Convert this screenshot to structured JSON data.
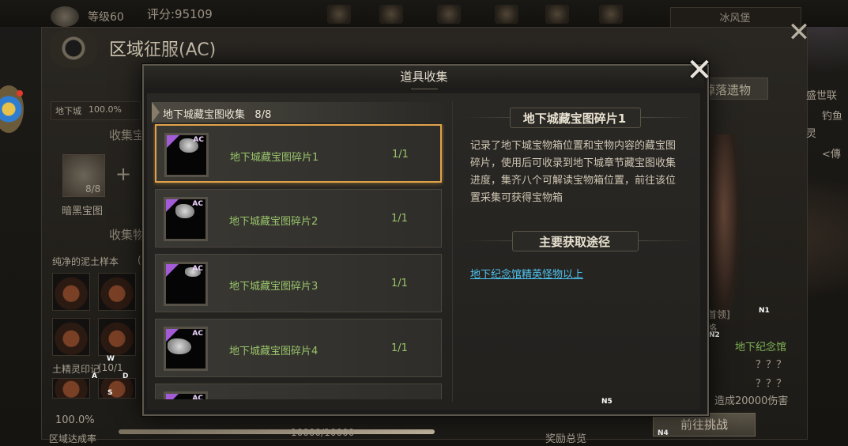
{
  "hud": {
    "level": "等级60",
    "score": "评分:95109",
    "city": "冰风堡"
  },
  "region": {
    "title": "区域征服(AC)",
    "dungeon_label": "地下城",
    "dungeon_percent": "100.0%",
    "collect_treasure_label": "收集宝",
    "map_count": "8/8",
    "map_name": "暗黑宝图",
    "collect_item_label": "收集物",
    "sample_label": "纯净的泥土样本",
    "sample_bracket": "(",
    "earth_spirit_label": "土精灵印记",
    "earth_spirit_count": "(10/1",
    "progress_percent": "100.0%",
    "progress_label": "区域达成率",
    "progress_value": "10000/10000",
    "progress_fraction": 1.0,
    "reward_label": "奖励总览",
    "right_tab": "掉落遗物",
    "right_frag_1": "盛世联",
    "right_frag_2": "钓鱼",
    "right_frag_3": "灵",
    "right_frag_4": "<傳",
    "right_frag_5": "首领]",
    "right_frag_6": "格",
    "dungeon_memorial": "地下纪念馆",
    "unknown_1": "？？？",
    "unknown_2": "？？？",
    "damage_text": "造成20000伤害",
    "challenge_button": "前往挑战"
  },
  "controls": {
    "w": "W",
    "a": "A",
    "s": "S",
    "d": "D",
    "n1": "N1",
    "n2": "N2",
    "n3": "N3",
    "n4": "N4",
    "n5": "N5"
  },
  "modal": {
    "title": "道具收集",
    "collection_header": "地下城藏宝图收集",
    "collection_progress": "8/8",
    "items": [
      {
        "name": "地下城藏宝图碎片1",
        "count": "1/1",
        "badge": "AC",
        "selected": true
      },
      {
        "name": "地下城藏宝图碎片2",
        "count": "1/1",
        "badge": "AC",
        "selected": false
      },
      {
        "name": "地下城藏宝图碎片3",
        "count": "1/1",
        "badge": "AC",
        "selected": false
      },
      {
        "name": "地下城藏宝图碎片4",
        "count": "1/1",
        "badge": "AC",
        "selected": false
      },
      {
        "name": "",
        "count": "",
        "badge": "AC",
        "selected": false
      }
    ],
    "detail": {
      "title": "地下城藏宝图碎片1",
      "description": "记录了地下城宝物箱位置和宝物内容的藏宝图碎片，使用后可收录到地下城章节藏宝图收集进度，集齐八个可解读宝物箱位置，前往该位置采集可获得宝物箱",
      "source_title": "主要获取途径",
      "source_link": "地下纪念馆精英怪物以上"
    }
  },
  "colors": {
    "selected_border": "#e0a24a",
    "item_text_green": "#98c46a",
    "link_blue": "#4fc3f0",
    "badge_purple": "#a45bd8"
  }
}
